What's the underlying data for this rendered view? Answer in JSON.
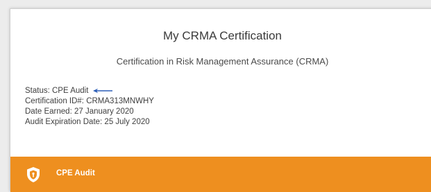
{
  "page": {
    "title": "My CRMA Certification",
    "subtitle": "Certification in Risk Management Assurance (CRMA)"
  },
  "details": {
    "status": "Status: CPE Audit",
    "certification_id": "Certification ID#: CRMA313MNWHY",
    "date_earned": "Date Earned: 27 January 2020",
    "audit_expiration": "Audit Expiration Date: 25 July 2020"
  },
  "banner": {
    "label": "CPE Audit",
    "icon": "shield-icon",
    "color": "#ee8f1f"
  },
  "annotation": {
    "icon": "arrow-left-icon",
    "color": "#2d5fb8"
  }
}
